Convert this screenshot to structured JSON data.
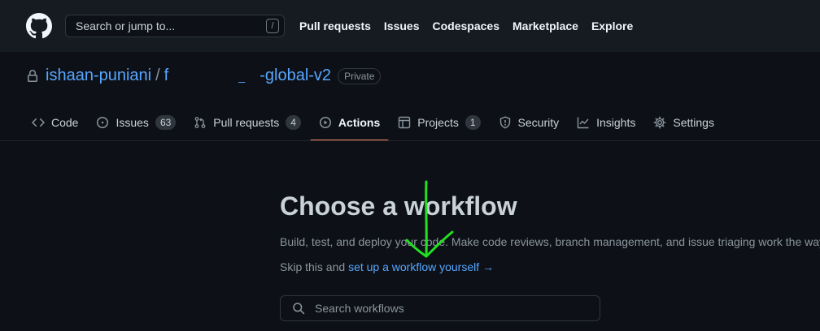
{
  "header": {
    "logo_icon": "github-mark-icon",
    "search_placeholder": "Search or jump to...",
    "search_shortcut": "/",
    "nav": [
      "Pull requests",
      "Issues",
      "Codespaces",
      "Marketplace",
      "Explore"
    ]
  },
  "repo": {
    "lock_icon": "lock-icon",
    "owner": "ishaan-puniani",
    "separator": "/",
    "name_start": "f",
    "name_hidden_mark": "_",
    "name_end": "-global-v2",
    "visibility": "Private"
  },
  "tabs": [
    {
      "label": "Code",
      "icon": "code-icon"
    },
    {
      "label": "Issues",
      "icon": "issue-opened-icon",
      "count": "63"
    },
    {
      "label": "Pull requests",
      "icon": "git-pull-request-icon",
      "count": "4"
    },
    {
      "label": "Actions",
      "icon": "play-icon",
      "active": true
    },
    {
      "label": "Projects",
      "icon": "table-icon",
      "count": "1"
    },
    {
      "label": "Security",
      "icon": "shield-icon"
    },
    {
      "label": "Insights",
      "icon": "graph-icon"
    },
    {
      "label": "Settings",
      "icon": "gear-icon"
    }
  ],
  "main": {
    "title": "Choose a workflow",
    "description": "Build, test, and deploy your code. Make code reviews, branch management, and issue triaging work the way",
    "skip_prefix": "Skip this and ",
    "skip_link": "set up a workflow yourself",
    "skip_arrow": "→",
    "search_placeholder": "Search workflows"
  },
  "colors": {
    "accent_link": "#58a6ff",
    "active_tab_underline": "#f78166",
    "annotation_arrow": "#22e022"
  }
}
